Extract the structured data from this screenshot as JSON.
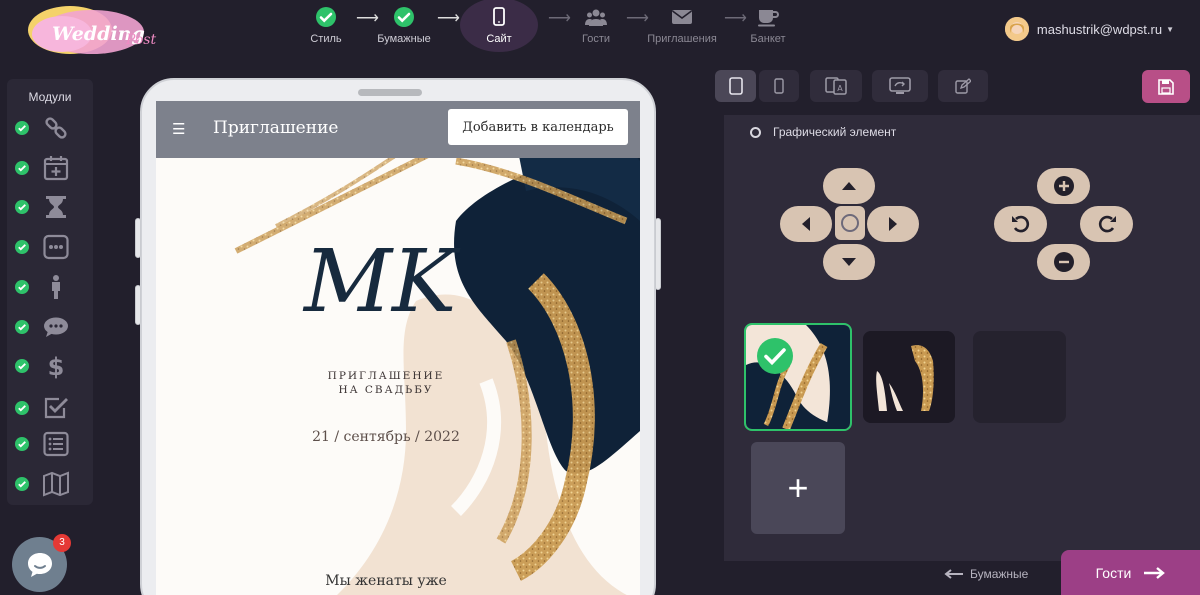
{
  "header": {
    "logo_text": "Wedding Post",
    "steps": [
      {
        "label": "Стиль",
        "state": "done",
        "icon": "check-icon"
      },
      {
        "label": "Бумажные",
        "state": "done",
        "icon": "check-icon"
      },
      {
        "label": "Сайт",
        "state": "active",
        "icon": "phone-icon"
      },
      {
        "label": "Гости",
        "state": "pending",
        "icon": "users-icon"
      },
      {
        "label": "Приглашения",
        "state": "pending",
        "icon": "envelope-icon"
      },
      {
        "label": "Банкет",
        "state": "pending",
        "icon": "coffee-icon"
      }
    ],
    "user_email": "mashustrik@wdpst.ru"
  },
  "modules": {
    "title": "Модули",
    "items": [
      {
        "icon": "link-icon",
        "enabled": true
      },
      {
        "icon": "calendar-plus-icon",
        "enabled": true
      },
      {
        "icon": "hourglass-icon",
        "enabled": true
      },
      {
        "icon": "dots-box-icon",
        "enabled": true
      },
      {
        "icon": "person-icon",
        "enabled": true
      },
      {
        "icon": "chat-bubble-icon",
        "enabled": true
      },
      {
        "icon": "dollar-icon",
        "enabled": true
      },
      {
        "icon": "checkbox-icon",
        "enabled": true
      },
      {
        "icon": "list-icon",
        "enabled": true
      },
      {
        "icon": "map-icon",
        "enabled": true
      }
    ]
  },
  "preview": {
    "menu_title": "Приглашение",
    "calendar_button": "Добавить в календарь",
    "monogram": "MK",
    "subtitle_line1": "ПРИГЛАШЕНИЕ",
    "subtitle_line2": "НА СВАДЬБУ",
    "date": "21 / сентябрь / 2022",
    "married_text": "Мы женаты уже"
  },
  "editor": {
    "option_label": "Графический элемент",
    "thumbnails": [
      {
        "name": "gold-navy-brush",
        "selected": true
      },
      {
        "name": "gold-strokes-dark",
        "selected": false
      },
      {
        "name": "empty",
        "selected": false
      }
    ],
    "add_label": "+"
  },
  "nav": {
    "back_label": "Бумажные",
    "next_label": "Гости"
  },
  "chat": {
    "unread_count": "3"
  },
  "colors": {
    "background": "#221f2c",
    "panel": "#2f2b3a",
    "accent_green": "#2ec26a",
    "accent_pink": "#b84f87",
    "next_button": "#9c3f86",
    "control_beige": "#d8c4b2"
  }
}
